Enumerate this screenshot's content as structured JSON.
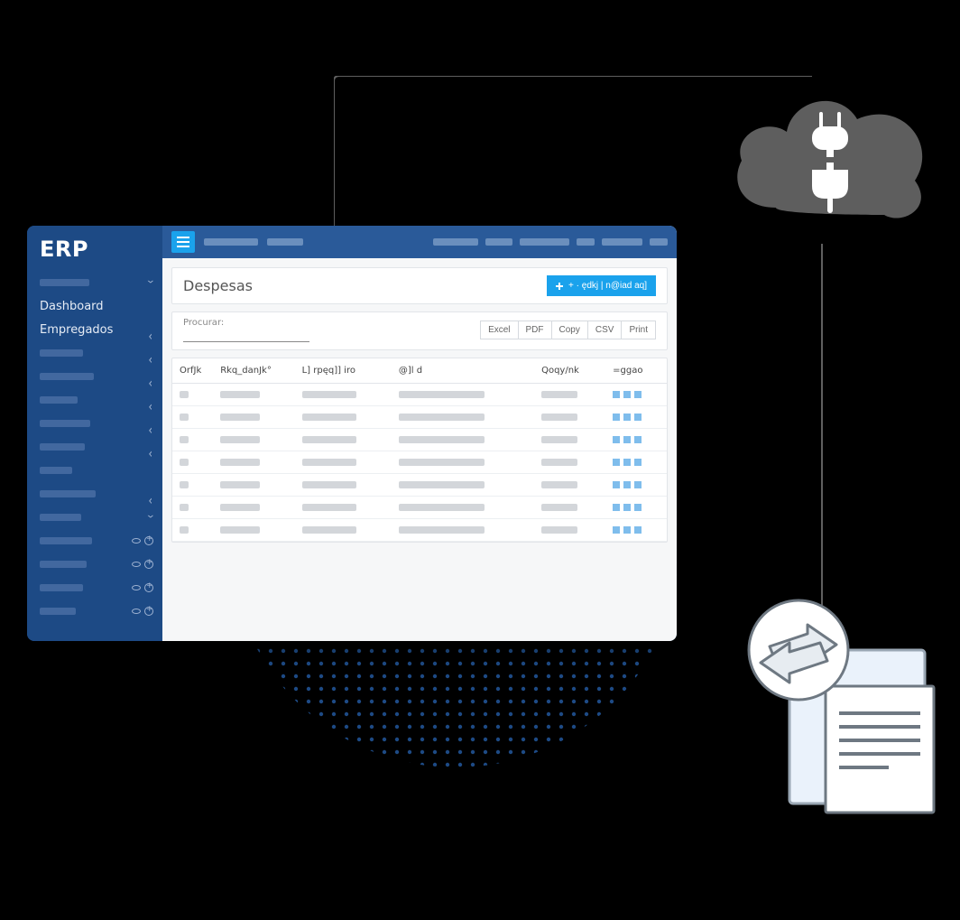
{
  "app": {
    "logo": "ERP",
    "colors": {
      "sidebar": "#1d4a85",
      "topbar": "#2a5a99",
      "accent": "#1aa2ec"
    }
  },
  "sidebar": {
    "items": [
      {
        "label": "Dashboard"
      },
      {
        "label": "Empregados"
      }
    ]
  },
  "page": {
    "title": "Despesas",
    "add_button": "+ · ędkj | n@iad aq]"
  },
  "search": {
    "label": "Procurar:",
    "value": ""
  },
  "export": {
    "buttons": [
      "Excel",
      "PDF",
      "Copy",
      "CSV",
      "Print"
    ]
  },
  "table": {
    "columns": [
      "OrfJk",
      "Rkq_danJk°",
      "L] rpęq]] iro",
      "@]l d",
      "Qoqy/nk",
      "=ggao"
    ],
    "row_count": 7
  }
}
